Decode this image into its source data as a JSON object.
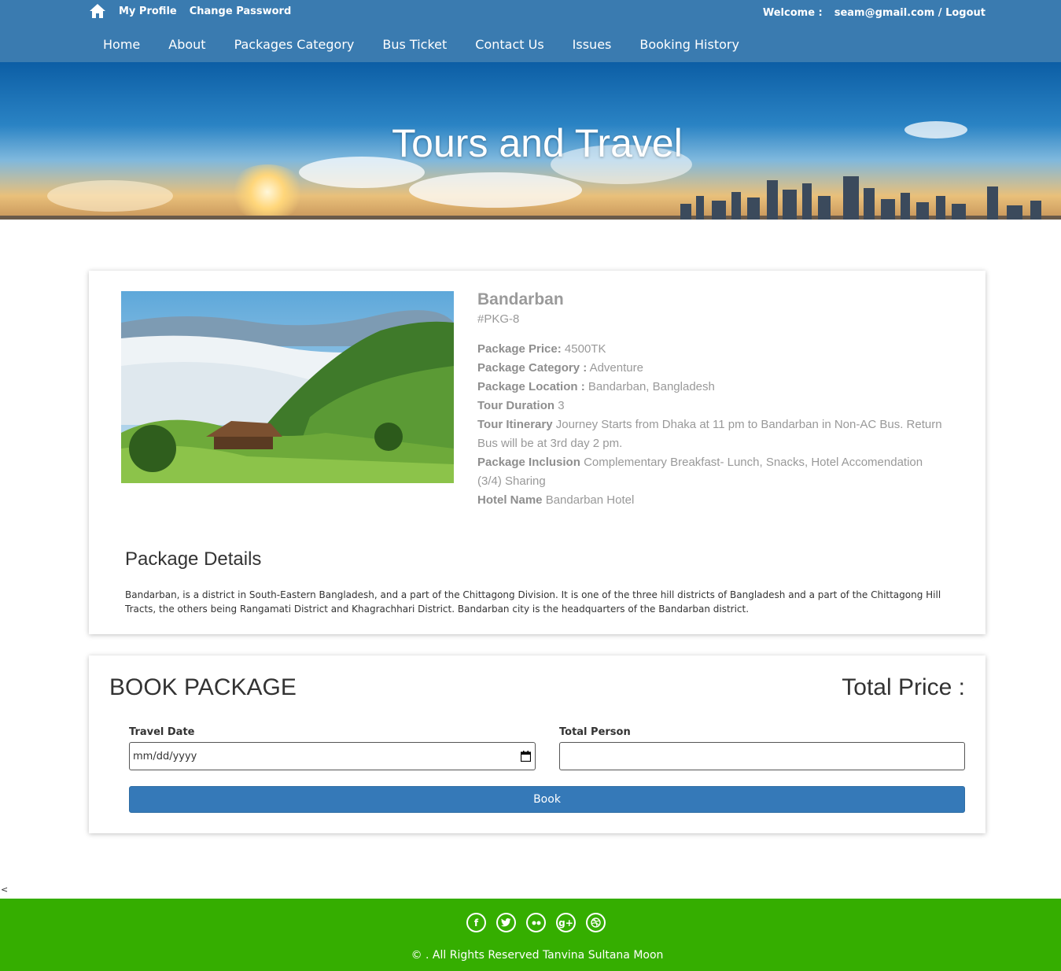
{
  "topbar": {
    "home_icon": "home-icon",
    "links": [
      "My Profile",
      "Change Password"
    ],
    "welcome_label": "Welcome :",
    "user_logout": "seam@gmail.com / Logout"
  },
  "nav": {
    "items": [
      "Home",
      "About",
      "Packages Category",
      "Bus Ticket",
      "Contact Us",
      "Issues",
      "Booking History"
    ]
  },
  "banner": {
    "title": "Tours and Travel"
  },
  "package": {
    "name": "Bandarban",
    "code": "#PKG-8",
    "price_label": "Package Price:",
    "price": "4500TK",
    "category_label": "Package Category :",
    "category": "Adventure",
    "location_label": "Package Location :",
    "location": "Bandarban, Bangladesh",
    "duration_label": "Tour Duration",
    "duration": "3",
    "itinerary_label": "Tour Itinerary",
    "itinerary": "Journey Starts from Dhaka at 11 pm to Bandarban in Non-AC Bus. Return Bus will be at 3rd day 2 pm.",
    "inclusion_label": "Package Inclusion",
    "inclusion": "Complementary Breakfast- Lunch, Snacks, Hotel Accomendation (3/4) Sharing",
    "hotel_label": "Hotel Name",
    "hotel": "Bandarban Hotel",
    "details_title": "Package Details",
    "details_text": "Bandarban, is a district in South-Eastern Bangladesh, and a part of the Chittagong Division. It is one of the three hill districts of Bangladesh and a part of the Chittagong Hill Tracts, the others being Rangamati District and Khagrachhari District. Bandarban city is the headquarters of the Bandarban district."
  },
  "booking": {
    "title": "BOOK PACKAGE",
    "total_price_label": "Total Price :",
    "travel_date_label": "Travel Date",
    "travel_date_placeholder": "mm/dd/yyyy",
    "total_person_label": "Total Person",
    "total_person_value": "",
    "book_button": "Book"
  },
  "stray_text": "<",
  "footer": {
    "socials": [
      "facebook-icon",
      "twitter-icon",
      "flickr-icon",
      "google-plus-icon",
      "dribbble-icon"
    ],
    "copyright": "© . All Rights Reserved Tanvina Sultana Moon"
  },
  "colors": {
    "topbar": "#3a7bb0",
    "button": "#3579b8",
    "footer": "#35ae00"
  }
}
